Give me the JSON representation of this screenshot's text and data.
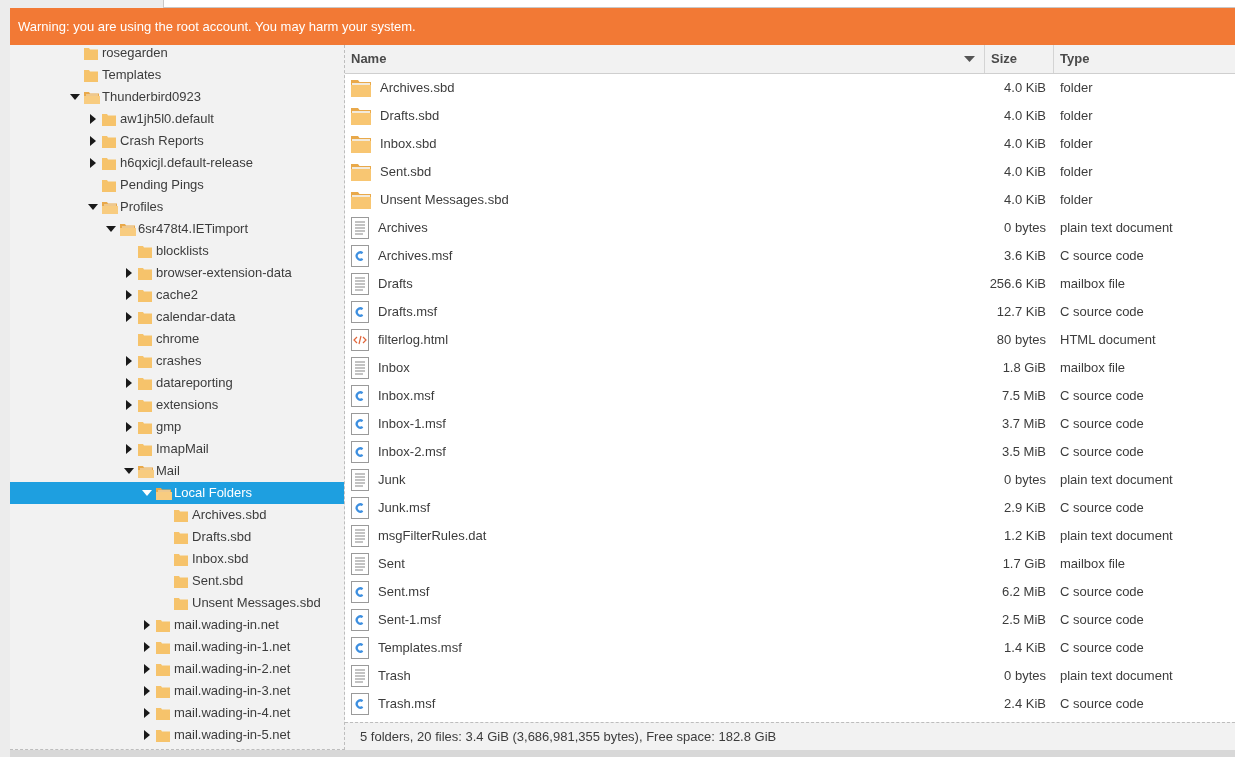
{
  "warning": "Warning: you are using the root account. You may harm your system.",
  "tree": [
    {
      "name": "rosegarden",
      "kind": "leaf",
      "selected": false
    },
    {
      "name": "Templates",
      "kind": "leaf",
      "selected": false
    },
    {
      "name": "Thunderbird0923",
      "kind": "branch",
      "expanded": true,
      "selected": false,
      "children": [
        {
          "name": "aw1jh5l0.default",
          "kind": "branch",
          "expanded": false,
          "selected": false
        },
        {
          "name": "Crash Reports",
          "kind": "branch",
          "expanded": false,
          "selected": false
        },
        {
          "name": "h6qxicjl.default-release",
          "kind": "branch",
          "expanded": false,
          "selected": false
        },
        {
          "name": "Pending Pings",
          "kind": "leaf",
          "selected": false
        },
        {
          "name": "Profiles",
          "kind": "branch",
          "expanded": true,
          "selected": false,
          "children": [
            {
              "name": "6sr478t4.IETimport",
              "kind": "branch",
              "expanded": true,
              "selected": false,
              "children": [
                {
                  "name": "blocklists",
                  "kind": "leaf",
                  "selected": false
                },
                {
                  "name": "browser-extension-data",
                  "kind": "branch",
                  "expanded": false,
                  "selected": false
                },
                {
                  "name": "cache2",
                  "kind": "branch",
                  "expanded": false,
                  "selected": false
                },
                {
                  "name": "calendar-data",
                  "kind": "branch",
                  "expanded": false,
                  "selected": false
                },
                {
                  "name": "chrome",
                  "kind": "leaf",
                  "selected": false
                },
                {
                  "name": "crashes",
                  "kind": "branch",
                  "expanded": false,
                  "selected": false
                },
                {
                  "name": "datareporting",
                  "kind": "branch",
                  "expanded": false,
                  "selected": false
                },
                {
                  "name": "extensions",
                  "kind": "branch",
                  "expanded": false,
                  "selected": false
                },
                {
                  "name": "gmp",
                  "kind": "branch",
                  "expanded": false,
                  "selected": false
                },
                {
                  "name": "ImapMail",
                  "kind": "branch",
                  "expanded": false,
                  "selected": false
                },
                {
                  "name": "Mail",
                  "kind": "branch",
                  "expanded": true,
                  "selected": false,
                  "children": [
                    {
                      "name": "Local Folders",
                      "kind": "branch",
                      "expanded": true,
                      "selected": true,
                      "children": [
                        {
                          "name": "Archives.sbd",
                          "kind": "leaf",
                          "selected": false
                        },
                        {
                          "name": "Drafts.sbd",
                          "kind": "leaf",
                          "selected": false
                        },
                        {
                          "name": "Inbox.sbd",
                          "kind": "leaf",
                          "selected": false
                        },
                        {
                          "name": "Sent.sbd",
                          "kind": "leaf",
                          "selected": false
                        },
                        {
                          "name": "Unsent Messages.sbd",
                          "kind": "leaf",
                          "selected": false
                        }
                      ]
                    },
                    {
                      "name": "mail.wading-in.net",
                      "kind": "branch",
                      "expanded": false,
                      "selected": false
                    },
                    {
                      "name": "mail.wading-in-1.net",
                      "kind": "branch",
                      "expanded": false,
                      "selected": false
                    },
                    {
                      "name": "mail.wading-in-2.net",
                      "kind": "branch",
                      "expanded": false,
                      "selected": false
                    },
                    {
                      "name": "mail.wading-in-3.net",
                      "kind": "branch",
                      "expanded": false,
                      "selected": false
                    },
                    {
                      "name": "mail.wading-in-4.net",
                      "kind": "branch",
                      "expanded": false,
                      "selected": false
                    },
                    {
                      "name": "mail.wading-in-5.net",
                      "kind": "branch",
                      "expanded": false,
                      "selected": false
                    }
                  ]
                }
              ]
            }
          ]
        }
      ]
    }
  ],
  "table": {
    "columns": [
      {
        "label": "Name",
        "sorted": true
      },
      {
        "label": "Size",
        "sorted": false
      },
      {
        "label": "Type",
        "sorted": false
      }
    ],
    "rows": [
      {
        "kind": "folder",
        "name": "Archives.sbd",
        "size": "4.0 KiB",
        "type": "folder"
      },
      {
        "kind": "folder",
        "name": "Drafts.sbd",
        "size": "4.0 KiB",
        "type": "folder"
      },
      {
        "kind": "folder",
        "name": "Inbox.sbd",
        "size": "4.0 KiB",
        "type": "folder"
      },
      {
        "kind": "folder",
        "name": "Sent.sbd",
        "size": "4.0 KiB",
        "type": "folder"
      },
      {
        "kind": "folder",
        "name": "Unsent Messages.sbd",
        "size": "4.0 KiB",
        "type": "folder"
      },
      {
        "kind": "text",
        "name": "Archives",
        "size": "0 bytes",
        "type": "plain text document"
      },
      {
        "kind": "c",
        "name": "Archives.msf",
        "size": "3.6 KiB",
        "type": "C source code"
      },
      {
        "kind": "text",
        "name": "Drafts",
        "size": "256.6 KiB",
        "type": "mailbox file"
      },
      {
        "kind": "c",
        "name": "Drafts.msf",
        "size": "12.7 KiB",
        "type": "C source code"
      },
      {
        "kind": "html",
        "name": "filterlog.html",
        "size": "80 bytes",
        "type": "HTML document"
      },
      {
        "kind": "text",
        "name": "Inbox",
        "size": "1.8 GiB",
        "type": "mailbox file"
      },
      {
        "kind": "c",
        "name": "Inbox.msf",
        "size": "7.5 MiB",
        "type": "C source code"
      },
      {
        "kind": "c",
        "name": "Inbox-1.msf",
        "size": "3.7 MiB",
        "type": "C source code"
      },
      {
        "kind": "c",
        "name": "Inbox-2.msf",
        "size": "3.5 MiB",
        "type": "C source code"
      },
      {
        "kind": "text",
        "name": "Junk",
        "size": "0 bytes",
        "type": "plain text document"
      },
      {
        "kind": "c",
        "name": "Junk.msf",
        "size": "2.9 KiB",
        "type": "C source code"
      },
      {
        "kind": "text",
        "name": "msgFilterRules.dat",
        "size": "1.2 KiB",
        "type": "plain text document"
      },
      {
        "kind": "text",
        "name": "Sent",
        "size": "1.7 GiB",
        "type": "mailbox file"
      },
      {
        "kind": "c",
        "name": "Sent.msf",
        "size": "6.2 MiB",
        "type": "C source code"
      },
      {
        "kind": "c",
        "name": "Sent-1.msf",
        "size": "2.5 MiB",
        "type": "C source code"
      },
      {
        "kind": "c",
        "name": "Templates.msf",
        "size": "1.4 KiB",
        "type": "C source code"
      },
      {
        "kind": "text",
        "name": "Trash",
        "size": "0 bytes",
        "type": "plain text document"
      },
      {
        "kind": "c",
        "name": "Trash.msf",
        "size": "2.4 KiB",
        "type": "C source code"
      }
    ]
  },
  "status_bar": "5 folders, 20 files: 3.4 GiB (3,686,981,355 bytes), Free space: 182.8 GiB"
}
